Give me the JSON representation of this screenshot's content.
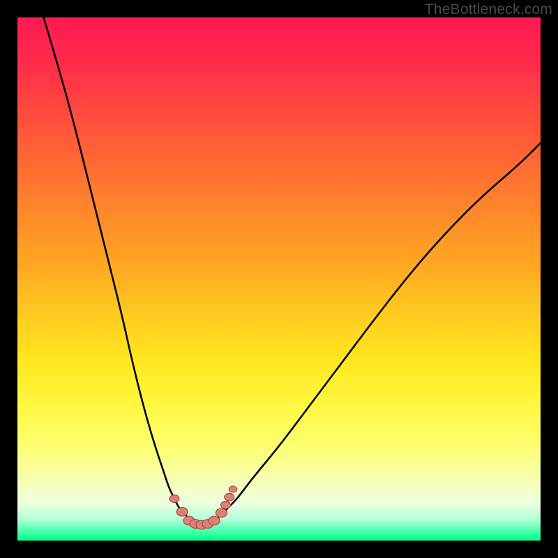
{
  "watermark": {
    "text": "TheBottleneck.com"
  },
  "colors": {
    "frame": "#000000",
    "curve_stroke": "#000000",
    "marker_fill": "#e17f77",
    "marker_stroke": "#9c4a43",
    "bottom_stripe": "#00ff88",
    "gradient_top": "#ff1a52"
  },
  "chart_data": {
    "type": "line",
    "title": "",
    "xlabel": "",
    "ylabel": "",
    "xlim": [
      0,
      100
    ],
    "ylim": [
      0,
      100
    ],
    "grid": false,
    "legend": null,
    "annotations": [],
    "curves": [
      {
        "name": "left_arc",
        "x": [
          5,
          8,
          11,
          14,
          17,
          20,
          22,
          24,
          26,
          28,
          29,
          30,
          31,
          32,
          33
        ],
        "y": [
          100,
          90,
          79,
          67,
          55,
          43,
          34,
          26,
          19,
          13,
          10,
          8,
          6,
          5,
          4
        ]
      },
      {
        "name": "right_arc",
        "x": [
          38,
          39,
          40,
          42,
          45,
          50,
          56,
          62,
          68,
          75,
          82,
          89,
          96,
          100
        ],
        "y": [
          4,
          5,
          6,
          8,
          12,
          18,
          26,
          34,
          42,
          51,
          59,
          66,
          72,
          76
        ]
      },
      {
        "name": "floor",
        "x": [
          33,
          34,
          35,
          36,
          37,
          38
        ],
        "y": [
          4,
          3.3,
          3.0,
          3.0,
          3.3,
          4
        ]
      }
    ],
    "markers": [
      {
        "x": 30.0,
        "y": 8.0,
        "r": 6
      },
      {
        "x": 31.5,
        "y": 5.5,
        "r": 7
      },
      {
        "x": 32.8,
        "y": 3.8,
        "r": 7
      },
      {
        "x": 34.0,
        "y": 3.2,
        "r": 7
      },
      {
        "x": 35.2,
        "y": 3.0,
        "r": 7
      },
      {
        "x": 36.4,
        "y": 3.2,
        "r": 7
      },
      {
        "x": 37.6,
        "y": 3.8,
        "r": 7
      },
      {
        "x": 39.0,
        "y": 5.3,
        "r": 7
      },
      {
        "x": 39.8,
        "y": 6.8,
        "r": 6
      },
      {
        "x": 40.5,
        "y": 8.3,
        "r": 6
      },
      {
        "x": 41.2,
        "y": 9.8,
        "r": 5
      }
    ]
  }
}
